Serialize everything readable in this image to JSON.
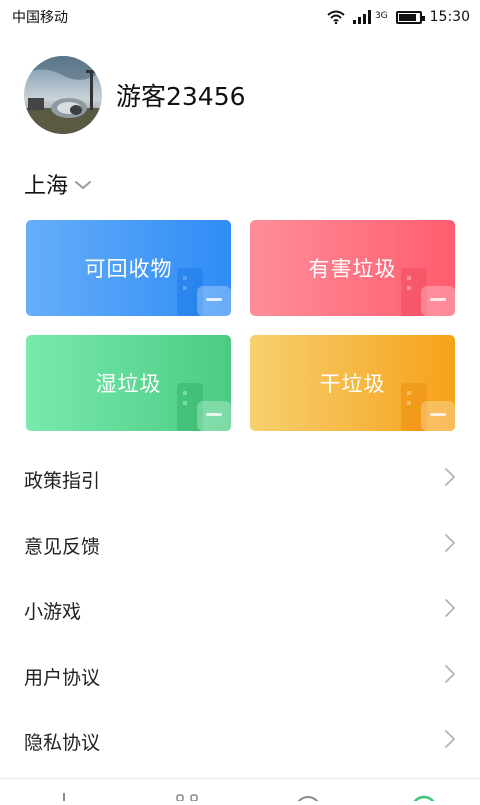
{
  "status_bar": {
    "carrier": "中国移动",
    "network": "3G",
    "time": "15:30",
    "battery_level": 0.85
  },
  "profile": {
    "username": "游客23456"
  },
  "city": {
    "name": "上海"
  },
  "categories": [
    {
      "label": "可回收物",
      "color": "#3a93f7"
    },
    {
      "label": "有害垃圾",
      "color": "#ff6878"
    },
    {
      "label": "湿垃圾",
      "color": "#58d28e"
    },
    {
      "label": "干垃圾",
      "color": "#f7ae2e"
    }
  ],
  "menu": [
    {
      "label": "政策指引"
    },
    {
      "label": "意见反馈"
    },
    {
      "label": "小游戏"
    },
    {
      "label": "用户协议"
    },
    {
      "label": "隐私协议"
    }
  ],
  "icons": {
    "wifi": "wifi-icon",
    "signal": "signal-icon",
    "battery": "battery-icon",
    "chevron_down": "chevron-down-icon",
    "chevron_right": "chevron-right-icon"
  }
}
